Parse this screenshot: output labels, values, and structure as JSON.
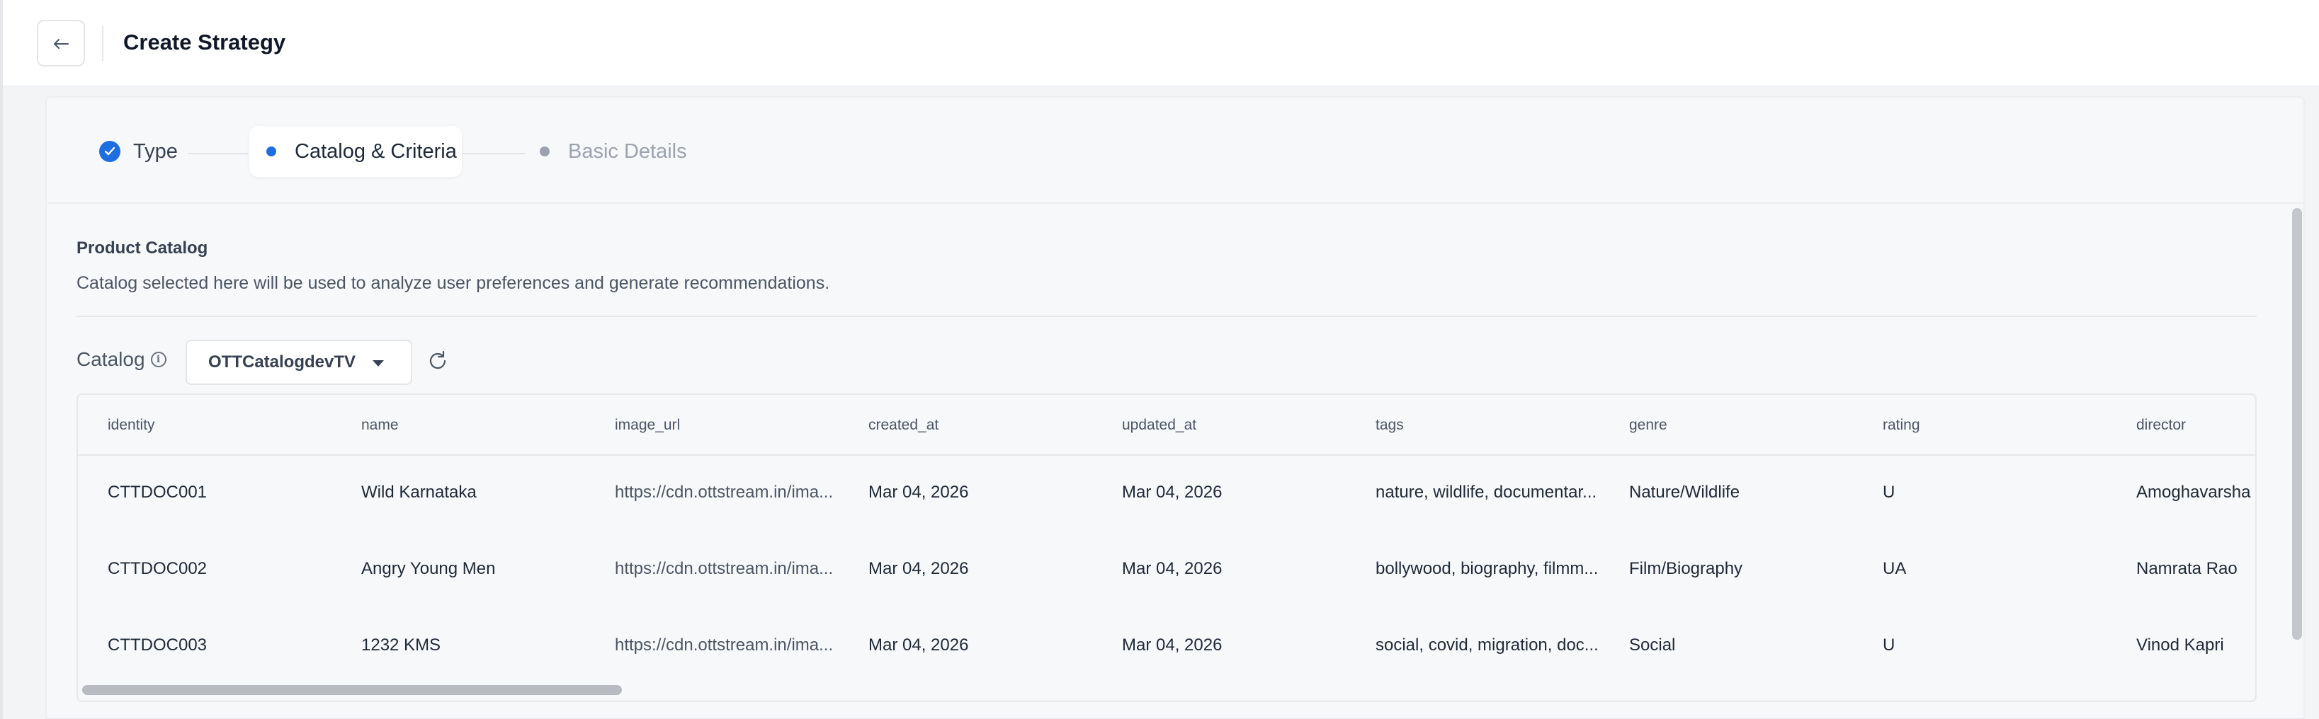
{
  "header": {
    "back_icon": "arrow-left-icon",
    "title": "Create Strategy"
  },
  "stepper": {
    "steps": [
      {
        "label": "Type",
        "status": "completed"
      },
      {
        "label": "Catalog & Criteria",
        "status": "active"
      },
      {
        "label": "Basic Details",
        "status": "pending"
      }
    ]
  },
  "product_catalog": {
    "title": "Product Catalog",
    "description": "Catalog selected here will be used to analyze user preferences and generate recommendations.",
    "catalog_label": "Catalog",
    "info_icon": "info-icon",
    "selected_catalog": "OTTCatalogdevTV",
    "refresh_icon": "refresh-icon"
  },
  "table": {
    "columns": [
      "identity",
      "name",
      "image_url",
      "created_at",
      "updated_at",
      "tags",
      "genre",
      "rating",
      "director"
    ],
    "rows": [
      [
        "CTTDOC001",
        "Wild Karnataka",
        "https://cdn.ottstream.in/ima...",
        "Mar 04, 2026",
        "Mar 04, 2026",
        "nature, wildlife, documentar...",
        "Nature/Wildlife",
        "U",
        "Amoghavarsha"
      ],
      [
        "CTTDOC002",
        "Angry Young Men",
        "https://cdn.ottstream.in/ima...",
        "Mar 04, 2026",
        "Mar 04, 2026",
        "bollywood, biography, filmm...",
        "Film/Biography",
        "UA",
        "Namrata Rao"
      ],
      [
        "CTTDOC003",
        "1232 KMS",
        "https://cdn.ottstream.in/ima...",
        "Mar 04, 2026",
        "Mar 04, 2026",
        "social, covid, migration, doc...",
        "Social",
        "U",
        "Vinod Kapri"
      ]
    ]
  },
  "colors": {
    "accent": "#1d6fe0",
    "inactive": "#9ca3af"
  }
}
